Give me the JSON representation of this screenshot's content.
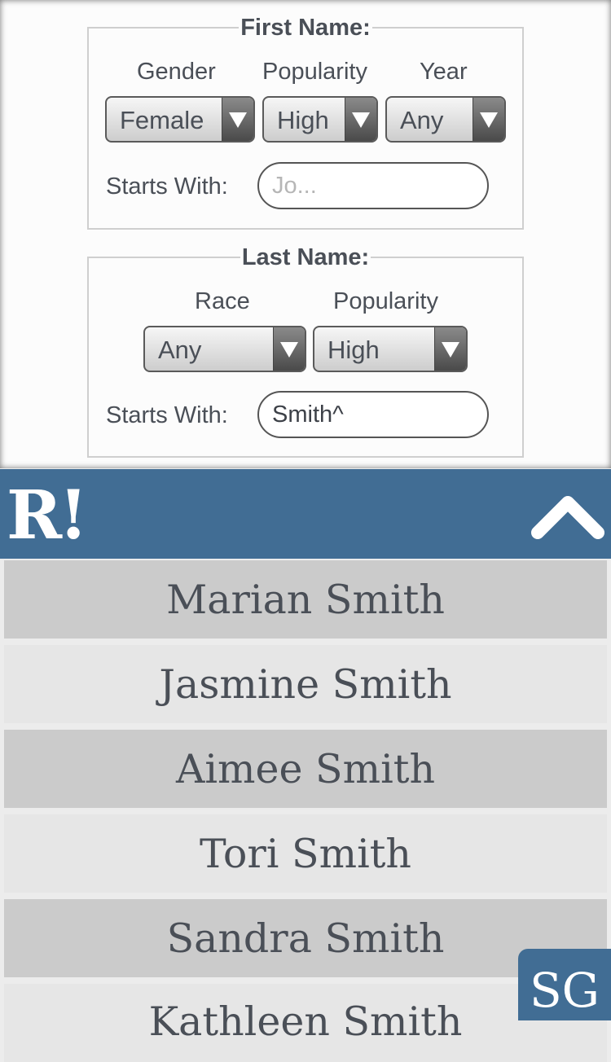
{
  "first_name": {
    "legend": "First Name:",
    "gender_label": "Gender",
    "popularity_label": "Popularity",
    "year_label": "Year",
    "gender_value": "Female",
    "popularity_value": "High",
    "year_value": "Any",
    "starts_with_label": "Starts With:",
    "starts_with_placeholder": "Jo...",
    "starts_with_value": ""
  },
  "last_name": {
    "legend": "Last Name:",
    "race_label": "Race",
    "popularity_label": "Popularity",
    "race_value": "Any",
    "popularity_value": "High",
    "starts_with_label": "Starts With:",
    "starts_with_value": "Smith^"
  },
  "header": {
    "logo_text": "R!",
    "collapse_icon": "chevron-up-icon",
    "color": "#416d94"
  },
  "results": [
    "Marian Smith",
    "Jasmine Smith",
    "Aimee Smith",
    "Tori Smith",
    "Sandra Smith",
    "Kathleen Smith"
  ],
  "badge": {
    "text": "SG"
  }
}
